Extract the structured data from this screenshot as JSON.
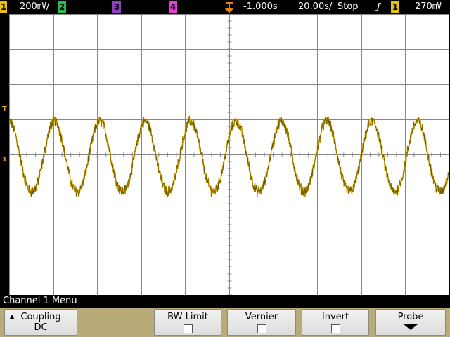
{
  "status_bar": {
    "ch1": {
      "num": "1",
      "scale": "200㎷/",
      "color": "#e8c000"
    },
    "ch2": {
      "num": "2",
      "color": "#22c04a"
    },
    "ch3": {
      "num": "3",
      "color": "#9040c0"
    },
    "ch4": {
      "num": "4",
      "color": "#e040d0"
    },
    "delay": "-1.000s",
    "timebase": "20.00s/",
    "run_state": "Stop",
    "trigger_slope_icon": "rising-edge-icon",
    "trigger_source": {
      "num": "1",
      "color": "#e8c000"
    },
    "trigger_level": "270㎷"
  },
  "screen": {
    "trace_color": "#e0b000",
    "grid_color": "#888888",
    "trigger_marker": "T",
    "ground_marker": "1",
    "trigger_level_divs": 0.54,
    "divisions": {
      "x": 10,
      "y": 8
    },
    "waveform": {
      "cycles": 9.7,
      "phase_offset": 0.0,
      "mean_divs": -0.05,
      "amplitude_divs": 1.0,
      "noise_divs": 0.14
    }
  },
  "menu": {
    "title": "Channel 1  Menu",
    "softkeys": [
      {
        "label": "Coupling",
        "value": "DC"
      },
      {
        "label": "BW Limit"
      },
      {
        "label": "Vernier"
      },
      {
        "label": "Invert"
      },
      {
        "label": "Probe"
      }
    ]
  }
}
